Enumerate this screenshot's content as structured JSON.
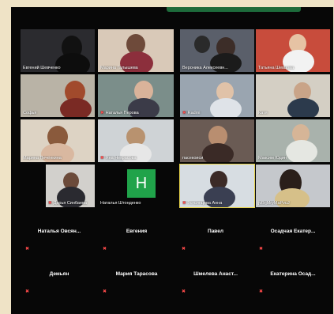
{
  "colors": {
    "accent_green": "#20a34a",
    "muted_mic": "#ff4a4a",
    "active_speaker": "#e6d24a"
  },
  "video_tiles": [
    {
      "name": "Евгений Шевченко",
      "muted": false
    },
    {
      "name": "Марина Галышева",
      "muted": false
    },
    {
      "name": "Вероника Алексеевн...",
      "muted": false
    },
    {
      "name": "Татьяна Шевцова",
      "muted": false
    },
    {
      "name": "Софья",
      "muted": false
    },
    {
      "name": "Наталья Перова",
      "muted": true
    },
    {
      "name": "Radmi",
      "muted": true
    },
    {
      "name": "Катя",
      "muted": false
    },
    {
      "name": "Марина Печёнкина",
      "muted": false
    },
    {
      "name": "Яна Некрасова",
      "muted": true
    },
    {
      "name": "пасекоиси",
      "muted": false
    },
    {
      "name": "Максим Юдин",
      "muted": false
    },
    {
      "name": "Дарья Синбаева",
      "muted": true
    },
    {
      "name": "Наталья Штонденко",
      "muted": false,
      "avatar_letter": "H"
    },
    {
      "name": "Устьянцева Анна",
      "muted": true
    },
    {
      "name": "jvBrjMryMaPvuJ",
      "muted": false
    }
  ],
  "name_only_tiles": [
    {
      "name": "Наталья Овсян..."
    },
    {
      "name": "Евгения"
    },
    {
      "name": "Павел"
    },
    {
      "name": "Осадчая Екатер..."
    },
    {
      "name": "Демьян"
    },
    {
      "name": "Мария Тарасова"
    },
    {
      "name": "Шмелева Анаст..."
    },
    {
      "name": "Екатерина Осад..."
    }
  ]
}
